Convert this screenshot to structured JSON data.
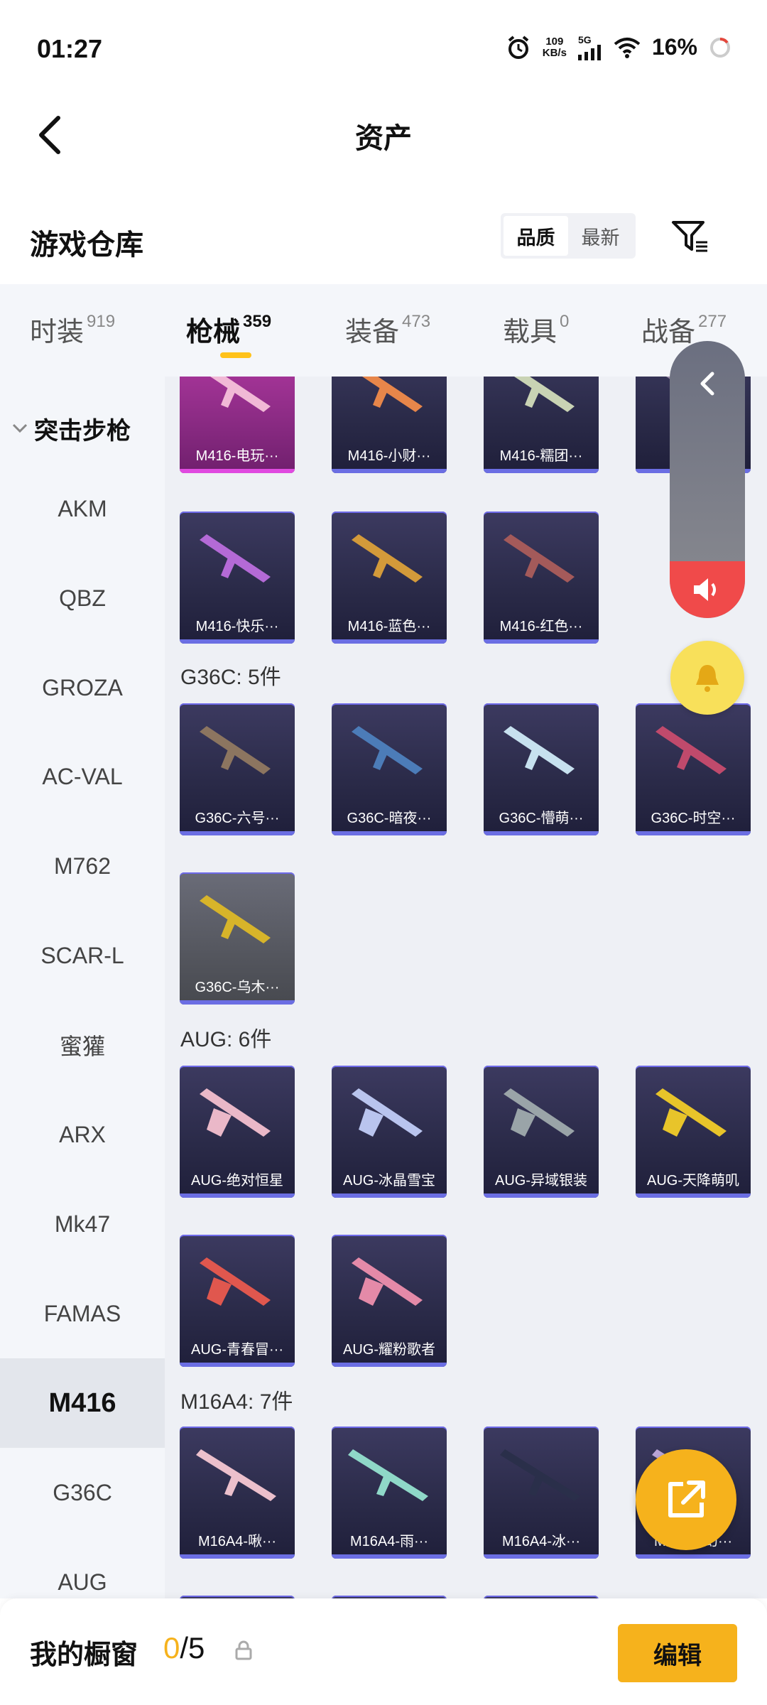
{
  "status": {
    "time": "01:27",
    "speed_top": "109",
    "speed_bottom": "KB/s",
    "net": "5G",
    "battery": "16%"
  },
  "header": {
    "title": "资产"
  },
  "warehouse": {
    "title": "游戏仓库",
    "sort_options": [
      "品质",
      "最新"
    ]
  },
  "tabs": [
    {
      "label": "时装",
      "count": "919"
    },
    {
      "label": "枪械",
      "count": "359"
    },
    {
      "label": "装备",
      "count": "473"
    },
    {
      "label": "载具",
      "count": "0"
    },
    {
      "label": "战备",
      "count": "277"
    }
  ],
  "sidebar": {
    "group": "突击步枪",
    "items": [
      "AKM",
      "QBZ",
      "GROZA",
      "AC-VAL",
      "M762",
      "SCAR-L",
      "蜜獾",
      "ARX",
      "Mk47",
      "FAMAS",
      "M416",
      "G36C",
      "AUG"
    ]
  },
  "groups": {
    "m416_items": [
      "M416-电玩···",
      "M416-小财···",
      "M416-糯团···",
      "M4",
      "M416-快乐···",
      "M416-蓝色···",
      "M416-红色···"
    ],
    "g36c": {
      "label": "G36C: 5件",
      "items": [
        "G36C-六号···",
        "G36C-暗夜···",
        "G36C-懵萌···",
        "G36C-时空···",
        "G36C-乌木···"
      ]
    },
    "aug": {
      "label": "AUG: 6件",
      "items": [
        "AUG-绝对恒星",
        "AUG-冰晶雪宝",
        "AUG-异域银装",
        "AUG-天降萌叽",
        "AUG-青春冒···",
        "AUG-耀粉歌者"
      ]
    },
    "m16a4": {
      "label": "M16A4: 7件",
      "items": [
        "M16A4-啾···",
        "M16A4-雨···",
        "M16A4-冰···",
        "M16A4-幻···"
      ]
    }
  },
  "bottom": {
    "label": "我的橱窗",
    "current": "0",
    "total": "/5",
    "edit": "编辑"
  }
}
